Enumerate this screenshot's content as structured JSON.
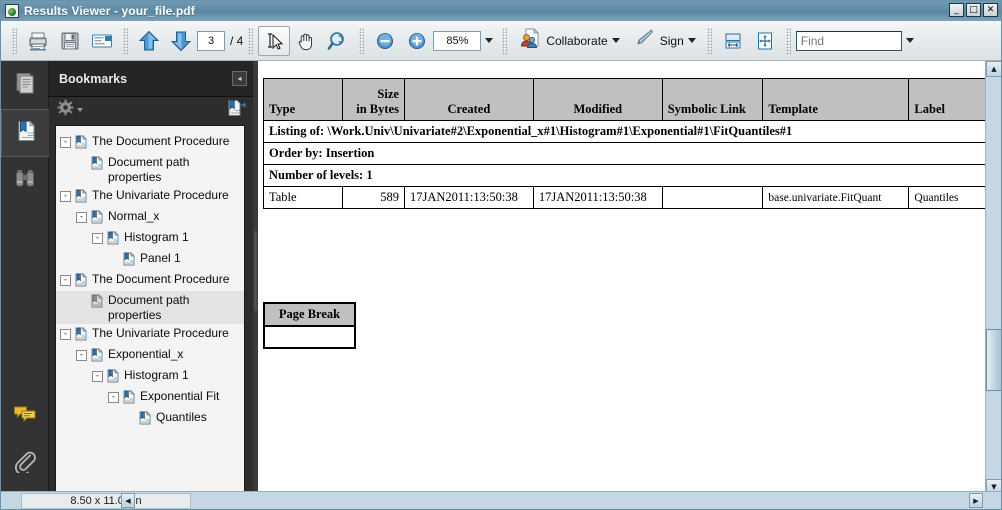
{
  "window": {
    "title": "Results Viewer - your_file.pdf",
    "app_icon": "pdf-document-icon",
    "buttons": {
      "minimize": "_",
      "maximize": "□",
      "close": "✕"
    }
  },
  "toolbar": {
    "print_label": "Print",
    "save_label": "Save",
    "email_label": "Email",
    "prev_page_label": "Previous Page",
    "next_page_label": "Next Page",
    "page_number": "3",
    "page_total": "/ 4",
    "select_tool_label": "Select Tool",
    "hand_tool_label": "Hand Tool",
    "marquee_zoom_label": "Marquee Zoom",
    "zoom_out_label": "Zoom Out",
    "zoom_in_label": "Zoom In",
    "zoom_value": "85%",
    "collaborate_label": "Collaborate",
    "sign_label": "Sign",
    "fit_width_label": "Fit Width",
    "fit_page_label": "Fit Page",
    "find_placeholder": "Find",
    "find_value": ""
  },
  "rail": {
    "items": [
      {
        "name": "pages-icon",
        "label": "Pages",
        "active": false
      },
      {
        "name": "bookmarks-icon",
        "label": "Bookmarks",
        "active": true
      },
      {
        "name": "binoculars-icon",
        "label": "Search",
        "active": false
      },
      {
        "name": "comments-icon",
        "label": "Comments",
        "active": false
      },
      {
        "name": "paperclip-icon",
        "label": "Attachments",
        "active": false
      }
    ]
  },
  "bookmarks_panel": {
    "title": "Bookmarks",
    "collapse_label": "◂",
    "options_label": "Options",
    "new_bookmark_label": "New Bookmark",
    "tree": [
      {
        "label": "The Document Procedure",
        "depth": 0,
        "toggle": "-",
        "selected": false
      },
      {
        "label": "Document path properties",
        "depth": 1,
        "toggle": "",
        "selected": false
      },
      {
        "label": "The Univariate Procedure",
        "depth": 0,
        "toggle": "-",
        "selected": false
      },
      {
        "label": "Normal_x",
        "depth": 1,
        "toggle": "-",
        "selected": false
      },
      {
        "label": "Histogram 1",
        "depth": 2,
        "toggle": "-",
        "selected": false
      },
      {
        "label": "Panel 1",
        "depth": 3,
        "toggle": "",
        "selected": false
      },
      {
        "label": "The Document Procedure",
        "depth": 0,
        "toggle": "-",
        "selected": false
      },
      {
        "label": "Document path properties",
        "depth": 1,
        "toggle": "",
        "selected": true
      },
      {
        "label": "The Univariate Procedure",
        "depth": 0,
        "toggle": "-",
        "selected": false
      },
      {
        "label": "Exponential_x",
        "depth": 1,
        "toggle": "-",
        "selected": false
      },
      {
        "label": "Histogram 1",
        "depth": 2,
        "toggle": "-",
        "selected": false
      },
      {
        "label": "Exponential Fit",
        "depth": 3,
        "toggle": "-",
        "selected": false
      },
      {
        "label": "Quantiles",
        "depth": 4,
        "toggle": "",
        "selected": false
      }
    ]
  },
  "document": {
    "listing_title": "Listing of: \\Work.Univ\\Univariate#2\\Exponential_x#1\\Histogram#1\\Exponential#1\\FitQuantiles#1",
    "order_by": "Order by: Insertion",
    "number_of_levels": "Number of levels: 1",
    "table": {
      "columns": [
        "Type",
        "Size\nin Bytes",
        "Created",
        "Modified",
        "Symbolic Link",
        "Template",
        "Label"
      ],
      "columns_flat": [
        "Type",
        "Size in Bytes",
        "Created",
        "Modified",
        "Symbolic Link",
        "Template",
        "Label"
      ],
      "col_size_line1": "Size",
      "col_size_line2": "in Bytes",
      "rows": [
        {
          "type": "Table",
          "size_in_bytes": "589",
          "created": "17JAN2011:13:50:38",
          "modified": "17JAN2011:13:50:38",
          "symbolic_link": "",
          "template": "base.univariate.FitQuant",
          "label": "Quantiles"
        }
      ]
    },
    "page_break_header": "Page Break",
    "page_break_body": ""
  },
  "status": {
    "page_size": "8.50 x 11.00 in",
    "hscroll_left_label": "◂",
    "hscroll_right_label": "▸"
  },
  "colors": {
    "titlebar": "#5f8ca6",
    "toolbar": "#e6eaec",
    "panel_dark": "#2d2d2d",
    "tree_bg": "#f4f4f4",
    "table_header": "#c0c0c0",
    "scrollbar": "#c5d7e2",
    "accent_blue": "#2a6ea8"
  }
}
